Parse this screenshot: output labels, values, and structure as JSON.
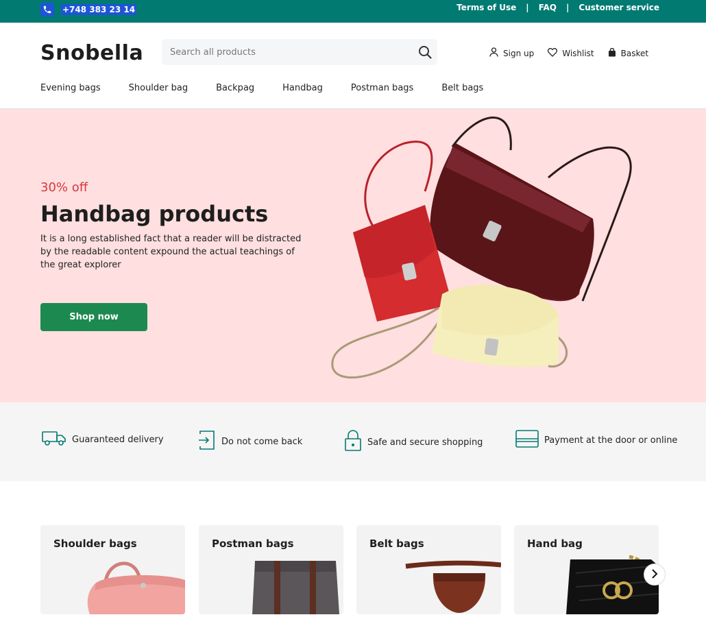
{
  "topbar": {
    "phone": "+748 383 23 14",
    "links": [
      "Terms of Use",
      "FAQ",
      "Customer service"
    ],
    "separator": "|",
    "color": "#017a72"
  },
  "header": {
    "logo": "Snobella",
    "search_placeholder": "Search all products",
    "actions": {
      "signup": "Sign up",
      "wishlist": "Wishlist",
      "basket": "Basket"
    },
    "nav": [
      "Evening bags",
      "Shoulder bag",
      "Backpag",
      "Handbag",
      "Postman bags",
      "Belt bags"
    ]
  },
  "hero": {
    "discount": "30% off",
    "title": "Handbag products",
    "description": "It is a long established fact that a reader will be distracted by the readable content expound the actual teachings of the great explorer",
    "button": "Shop now",
    "background": "#ffdfdf",
    "button_color": "#1c8a50"
  },
  "features": [
    {
      "icon": "truck-icon",
      "label": "Guaranteed delivery"
    },
    {
      "icon": "return-icon",
      "label": "Do not come back"
    },
    {
      "icon": "lock-icon",
      "label": "Safe and secure shopping"
    },
    {
      "icon": "card-icon",
      "label": "Payment at the door or online"
    }
  ],
  "categories": [
    {
      "title": "Shoulder bags"
    },
    {
      "title": "Postman bags"
    },
    {
      "title": "Belt bags"
    },
    {
      "title": "Hand bag"
    }
  ]
}
